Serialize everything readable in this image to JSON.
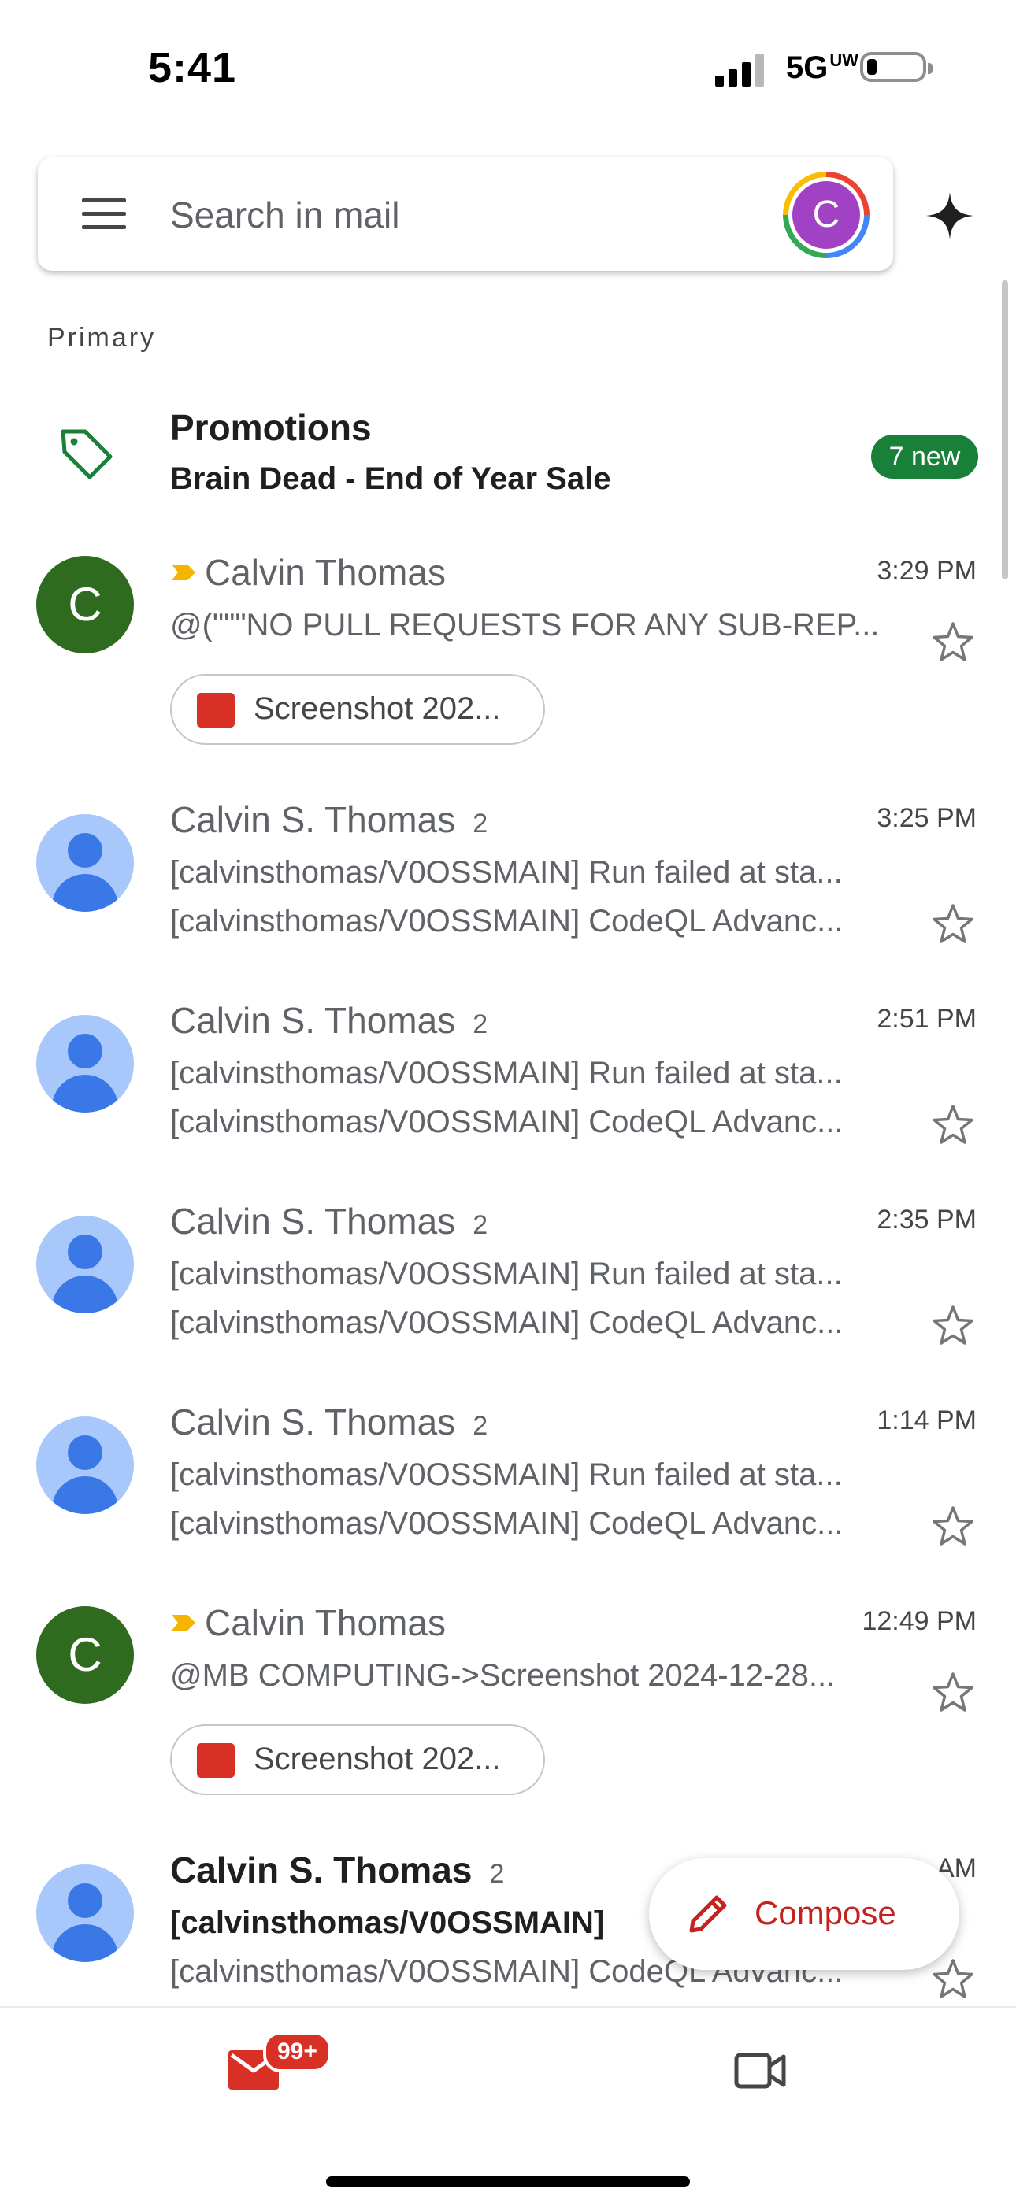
{
  "status_bar": {
    "time": "5:41",
    "network": "5G",
    "network_suffix": "UW"
  },
  "search": {
    "placeholder": "Search in mail",
    "avatar_letter": "C"
  },
  "section_label": "Primary",
  "promotions": {
    "title": "Promotions",
    "subtitle": "Brain Dead - End of Year Sale",
    "badge": "7 new"
  },
  "emails": [
    {
      "sender": "Calvin Thomas",
      "count": "",
      "time": "3:29 PM",
      "line1": "@(\"\"\"NO PULL REQUESTS FOR ANY SUB-REP...",
      "line2": "",
      "attachment": "Screenshot 202...",
      "avatar": "C",
      "important": true,
      "unread": false
    },
    {
      "sender": "Calvin S. Thomas",
      "count": "2",
      "time": "3:25 PM",
      "line1": "[calvinsthomas/V0OSSMAIN] Run failed at sta...",
      "line2": "[calvinsthomas/V0OSSMAIN] CodeQL Advanc...",
      "attachment": "",
      "avatar": "",
      "important": false,
      "unread": false
    },
    {
      "sender": "Calvin S. Thomas",
      "count": "2",
      "time": "2:51 PM",
      "line1": "[calvinsthomas/V0OSSMAIN] Run failed at sta...",
      "line2": "[calvinsthomas/V0OSSMAIN] CodeQL Advanc...",
      "attachment": "",
      "avatar": "",
      "important": false,
      "unread": false
    },
    {
      "sender": "Calvin S. Thomas",
      "count": "2",
      "time": "2:35 PM",
      "line1": "[calvinsthomas/V0OSSMAIN] Run failed at sta...",
      "line2": "[calvinsthomas/V0OSSMAIN] CodeQL Advanc...",
      "attachment": "",
      "avatar": "",
      "important": false,
      "unread": false
    },
    {
      "sender": "Calvin S. Thomas",
      "count": "2",
      "time": "1:14 PM",
      "line1": "[calvinsthomas/V0OSSMAIN] Run failed at sta...",
      "line2": "[calvinsthomas/V0OSSMAIN] CodeQL Advanc...",
      "attachment": "",
      "avatar": "",
      "important": false,
      "unread": false
    },
    {
      "sender": "Calvin Thomas",
      "count": "",
      "time": "12:49 PM",
      "line1": "@MB COMPUTING->Screenshot 2024-12-28...",
      "line2": "",
      "attachment": "Screenshot 202...",
      "avatar": "C",
      "important": true,
      "unread": false
    },
    {
      "sender": "Calvin S. Thomas",
      "count": "2",
      "time": "AM",
      "line1": "[calvinsthomas/V0OSSMAIN]",
      "line2": "[calvinsthomas/V0OSSMAIN] CodeQL Advanc...",
      "attachment": "",
      "avatar": "",
      "important": false,
      "unread": true
    }
  ],
  "compose": {
    "label": "Compose"
  },
  "bottom_nav": {
    "mail_badge": "99+"
  },
  "colors": {
    "accent_red": "#d93025",
    "promo_green": "#188038",
    "important_yellow": "#f4b400"
  }
}
